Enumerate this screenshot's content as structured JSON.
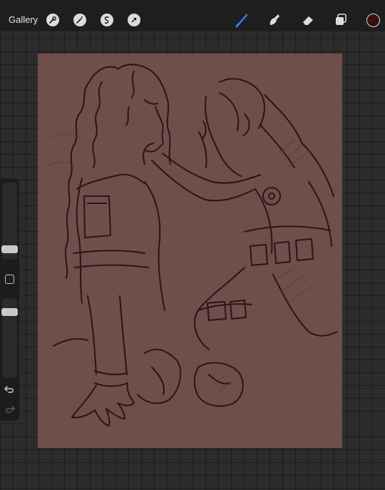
{
  "header": {
    "gallery_label": "Gallery",
    "left_tools": [
      "wrench-icon",
      "magic-wand-icon",
      "selection-icon",
      "transform-arrow-icon"
    ],
    "right_tools": [
      "brush-icon",
      "smudge-icon",
      "eraser-icon",
      "layers-icon"
    ],
    "active_tool": "brush-icon",
    "accent_color": "#3b7cff",
    "current_color": "#3a0f0f"
  },
  "canvas": {
    "background_color": "#6f4e4b",
    "line_color": "#2e1414"
  },
  "sidebar": {
    "brush_size_level": 0.78,
    "opacity_level": 0.15,
    "icons": [
      "modify-square-icon",
      "undo-icon",
      "redo-icon"
    ]
  }
}
